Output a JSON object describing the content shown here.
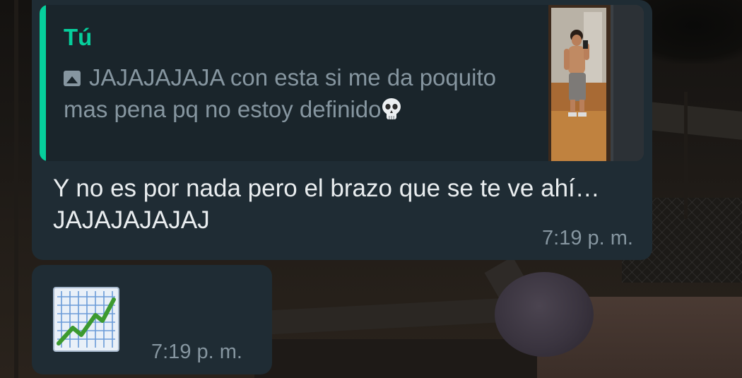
{
  "messages": [
    {
      "reply": {
        "author": "Tú",
        "media_icon": "photo-icon",
        "text": "JAJAJAJAJA con esta si me da poquito mas pena pq no estoy definido",
        "emoji": "skull-emoji"
      },
      "text": "Y no es por nada pero el brazo que se te ve ahí… JAJAJAJAJAJ",
      "time": "7:19 p. m."
    },
    {
      "emoji": "chart-increasing-emoji",
      "time": "7:19 p. m."
    }
  ],
  "colors": {
    "bubble_incoming": "#1f2c34",
    "quote_background": "#1a252b",
    "quote_accent": "#06cf9c",
    "text_primary": "#e9edef",
    "text_secondary": "#8696a0"
  }
}
